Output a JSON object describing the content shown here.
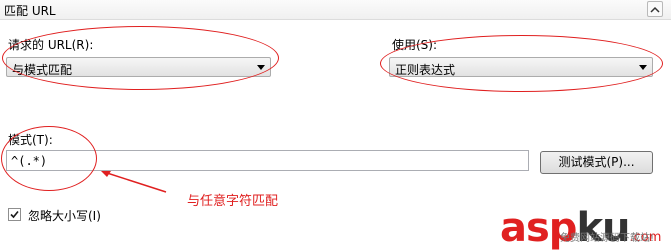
{
  "header": {
    "title": "匹配 URL"
  },
  "request_url": {
    "label": "请求的 URL(R):",
    "value": "与模式匹配"
  },
  "use": {
    "label": "使用(S):",
    "value": "正则表达式"
  },
  "pattern": {
    "label": "模式(T):",
    "value": "^(.*)",
    "test_button": "测试模式(P)..."
  },
  "ignore_case": {
    "label": "忽略大小写(I)",
    "checked": true
  },
  "annotation": {
    "text": "与任意字符匹配",
    "color": "#e02020"
  },
  "watermark": {
    "main_a": "asp",
    "main_b": "ku",
    "main_c": ".com",
    "sub": "免费网站源码下载站!"
  }
}
